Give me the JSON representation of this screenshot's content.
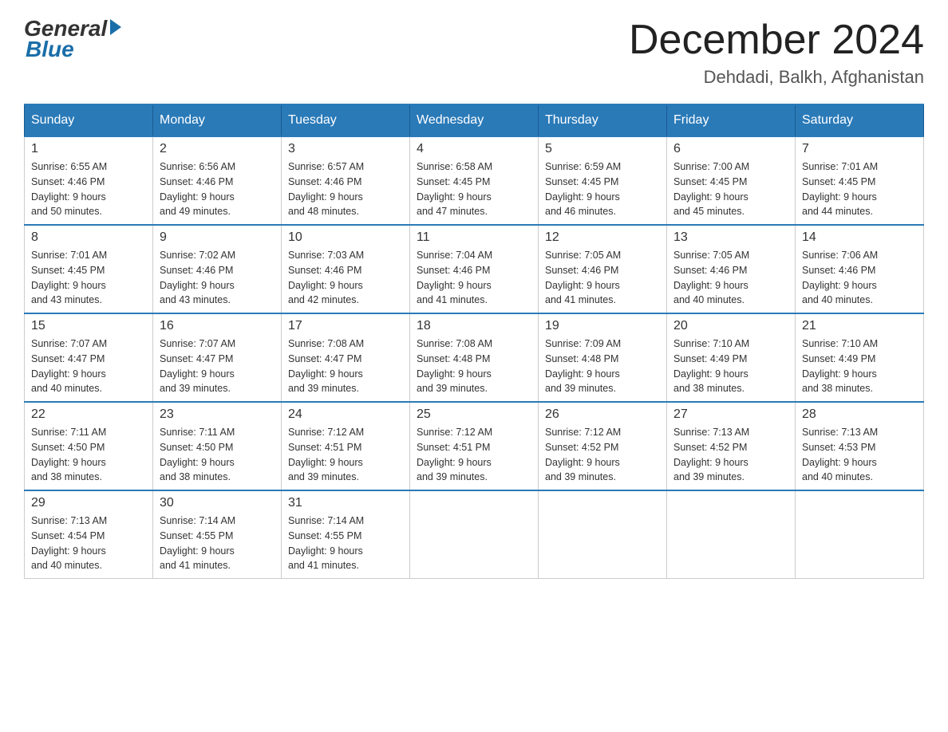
{
  "logo": {
    "general": "General",
    "blue": "Blue"
  },
  "title": "December 2024",
  "location": "Dehdadi, Balkh, Afghanistan",
  "weekdays": [
    "Sunday",
    "Monday",
    "Tuesday",
    "Wednesday",
    "Thursday",
    "Friday",
    "Saturday"
  ],
  "weeks": [
    [
      {
        "day": "1",
        "sunrise": "6:55 AM",
        "sunset": "4:46 PM",
        "daylight": "9 hours and 50 minutes."
      },
      {
        "day": "2",
        "sunrise": "6:56 AM",
        "sunset": "4:46 PM",
        "daylight": "9 hours and 49 minutes."
      },
      {
        "day": "3",
        "sunrise": "6:57 AM",
        "sunset": "4:46 PM",
        "daylight": "9 hours and 48 minutes."
      },
      {
        "day": "4",
        "sunrise": "6:58 AM",
        "sunset": "4:45 PM",
        "daylight": "9 hours and 47 minutes."
      },
      {
        "day": "5",
        "sunrise": "6:59 AM",
        "sunset": "4:45 PM",
        "daylight": "9 hours and 46 minutes."
      },
      {
        "day": "6",
        "sunrise": "7:00 AM",
        "sunset": "4:45 PM",
        "daylight": "9 hours and 45 minutes."
      },
      {
        "day": "7",
        "sunrise": "7:01 AM",
        "sunset": "4:45 PM",
        "daylight": "9 hours and 44 minutes."
      }
    ],
    [
      {
        "day": "8",
        "sunrise": "7:01 AM",
        "sunset": "4:45 PM",
        "daylight": "9 hours and 43 minutes."
      },
      {
        "day": "9",
        "sunrise": "7:02 AM",
        "sunset": "4:46 PM",
        "daylight": "9 hours and 43 minutes."
      },
      {
        "day": "10",
        "sunrise": "7:03 AM",
        "sunset": "4:46 PM",
        "daylight": "9 hours and 42 minutes."
      },
      {
        "day": "11",
        "sunrise": "7:04 AM",
        "sunset": "4:46 PM",
        "daylight": "9 hours and 41 minutes."
      },
      {
        "day": "12",
        "sunrise": "7:05 AM",
        "sunset": "4:46 PM",
        "daylight": "9 hours and 41 minutes."
      },
      {
        "day": "13",
        "sunrise": "7:05 AM",
        "sunset": "4:46 PM",
        "daylight": "9 hours and 40 minutes."
      },
      {
        "day": "14",
        "sunrise": "7:06 AM",
        "sunset": "4:46 PM",
        "daylight": "9 hours and 40 minutes."
      }
    ],
    [
      {
        "day": "15",
        "sunrise": "7:07 AM",
        "sunset": "4:47 PM",
        "daylight": "9 hours and 40 minutes."
      },
      {
        "day": "16",
        "sunrise": "7:07 AM",
        "sunset": "4:47 PM",
        "daylight": "9 hours and 39 minutes."
      },
      {
        "day": "17",
        "sunrise": "7:08 AM",
        "sunset": "4:47 PM",
        "daylight": "9 hours and 39 minutes."
      },
      {
        "day": "18",
        "sunrise": "7:08 AM",
        "sunset": "4:48 PM",
        "daylight": "9 hours and 39 minutes."
      },
      {
        "day": "19",
        "sunrise": "7:09 AM",
        "sunset": "4:48 PM",
        "daylight": "9 hours and 39 minutes."
      },
      {
        "day": "20",
        "sunrise": "7:10 AM",
        "sunset": "4:49 PM",
        "daylight": "9 hours and 38 minutes."
      },
      {
        "day": "21",
        "sunrise": "7:10 AM",
        "sunset": "4:49 PM",
        "daylight": "9 hours and 38 minutes."
      }
    ],
    [
      {
        "day": "22",
        "sunrise": "7:11 AM",
        "sunset": "4:50 PM",
        "daylight": "9 hours and 38 minutes."
      },
      {
        "day": "23",
        "sunrise": "7:11 AM",
        "sunset": "4:50 PM",
        "daylight": "9 hours and 38 minutes."
      },
      {
        "day": "24",
        "sunrise": "7:12 AM",
        "sunset": "4:51 PM",
        "daylight": "9 hours and 39 minutes."
      },
      {
        "day": "25",
        "sunrise": "7:12 AM",
        "sunset": "4:51 PM",
        "daylight": "9 hours and 39 minutes."
      },
      {
        "day": "26",
        "sunrise": "7:12 AM",
        "sunset": "4:52 PM",
        "daylight": "9 hours and 39 minutes."
      },
      {
        "day": "27",
        "sunrise": "7:13 AM",
        "sunset": "4:52 PM",
        "daylight": "9 hours and 39 minutes."
      },
      {
        "day": "28",
        "sunrise": "7:13 AM",
        "sunset": "4:53 PM",
        "daylight": "9 hours and 40 minutes."
      }
    ],
    [
      {
        "day": "29",
        "sunrise": "7:13 AM",
        "sunset": "4:54 PM",
        "daylight": "9 hours and 40 minutes."
      },
      {
        "day": "30",
        "sunrise": "7:14 AM",
        "sunset": "4:55 PM",
        "daylight": "9 hours and 41 minutes."
      },
      {
        "day": "31",
        "sunrise": "7:14 AM",
        "sunset": "4:55 PM",
        "daylight": "9 hours and 41 minutes."
      },
      null,
      null,
      null,
      null
    ]
  ],
  "labels": {
    "sunrise": "Sunrise: ",
    "sunset": "Sunset: ",
    "daylight": "Daylight: "
  }
}
